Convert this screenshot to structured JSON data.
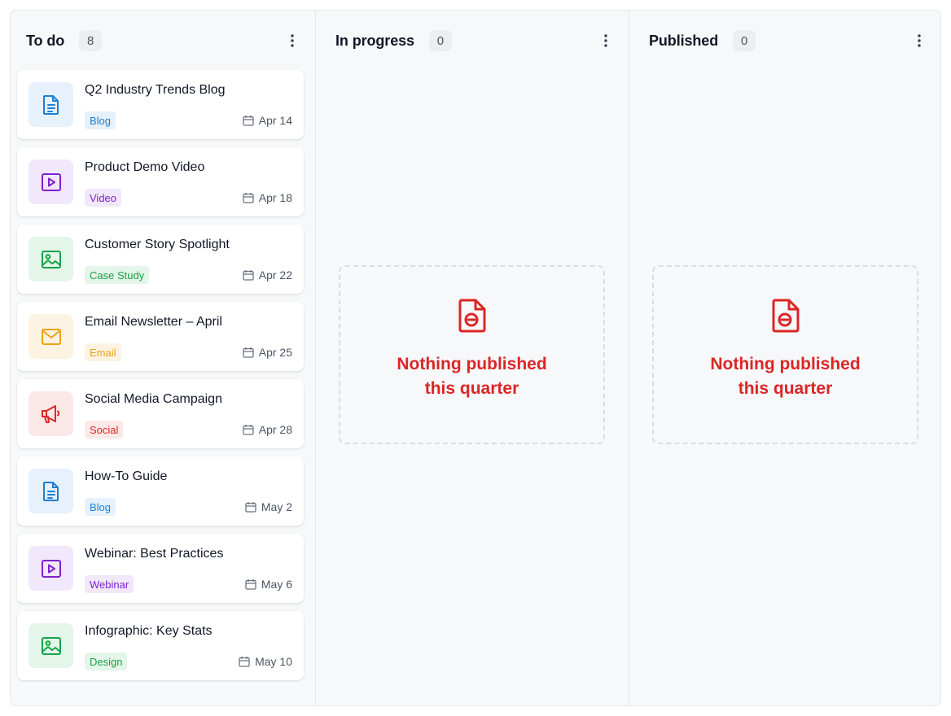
{
  "columns": [
    {
      "title": "To do",
      "count": "8",
      "cards": [
        {
          "title": "Q2 Industry Trends Blog",
          "tag": "Blog",
          "date": "Apr 14",
          "icon": "document-icon"
        },
        {
          "title": "Product Demo Video",
          "tag": "Video",
          "date": "Apr 18",
          "icon": "video-play-icon"
        },
        {
          "title": "Customer Story Spotlight",
          "tag": "Case Study",
          "date": "Apr 22",
          "icon": "image-icon"
        },
        {
          "title": "Email Newsletter – April",
          "tag": "Email",
          "date": "Apr 25",
          "icon": "envelope-icon"
        },
        {
          "title": "Social Media Campaign",
          "tag": "Social",
          "date": "Apr 28",
          "icon": "megaphone-icon"
        },
        {
          "title": "How-To Guide",
          "tag": "Blog",
          "date": "May 2",
          "icon": "document-icon"
        },
        {
          "title": "Webinar: Best Practices",
          "tag": "Webinar",
          "date": "May 6",
          "icon": "video-play-icon"
        },
        {
          "title": "Infographic: Key Stats",
          "tag": "Design",
          "date": "May 10",
          "icon": "image-icon"
        }
      ]
    },
    {
      "title": "In progress",
      "count": "0",
      "empty_line1": "Nothing published",
      "empty_line2": "this quarter"
    },
    {
      "title": "Published",
      "count": "0",
      "empty_line1": "Nothing published",
      "empty_line2": "this quarter"
    }
  ],
  "colors": {
    "blue": "#1d7fd1",
    "blue_bg": "#e6f1fb",
    "purple": "#7e22ce",
    "purple_bg": "#f1e8fb",
    "green": "#16a34a",
    "green_bg": "#e4f5e9",
    "amber": "#e8a317",
    "amber_bg": "#fdf3e2",
    "red": "#dc2626",
    "red_bg": "#fde8e8"
  }
}
